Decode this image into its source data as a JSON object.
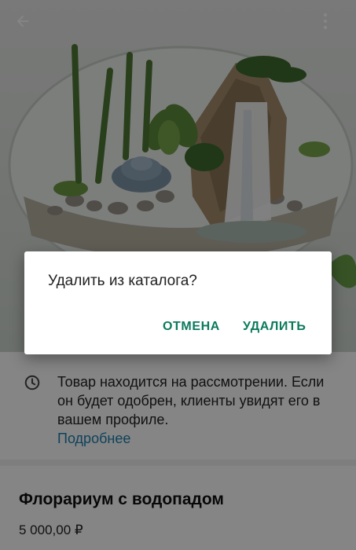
{
  "screen": {
    "back_icon": "arrow-left-icon",
    "menu_icon": "more-vertical-icon"
  },
  "notice": {
    "icon": "clock-icon",
    "text": "Товар находится на рассмотрении. Если он будет одобрен, клиенты увидят его в вашем профиле.",
    "link": "Подробнее",
    "link_color": "#1b7fae"
  },
  "product": {
    "title": "Флорариум с водопадом",
    "price": "5 000,00 ₽"
  },
  "dialog": {
    "title": "Удалить из каталога?",
    "cancel_label": "ОТМЕНА",
    "delete_label": "УДАЛИТЬ",
    "accent": "#0b7a5c"
  }
}
